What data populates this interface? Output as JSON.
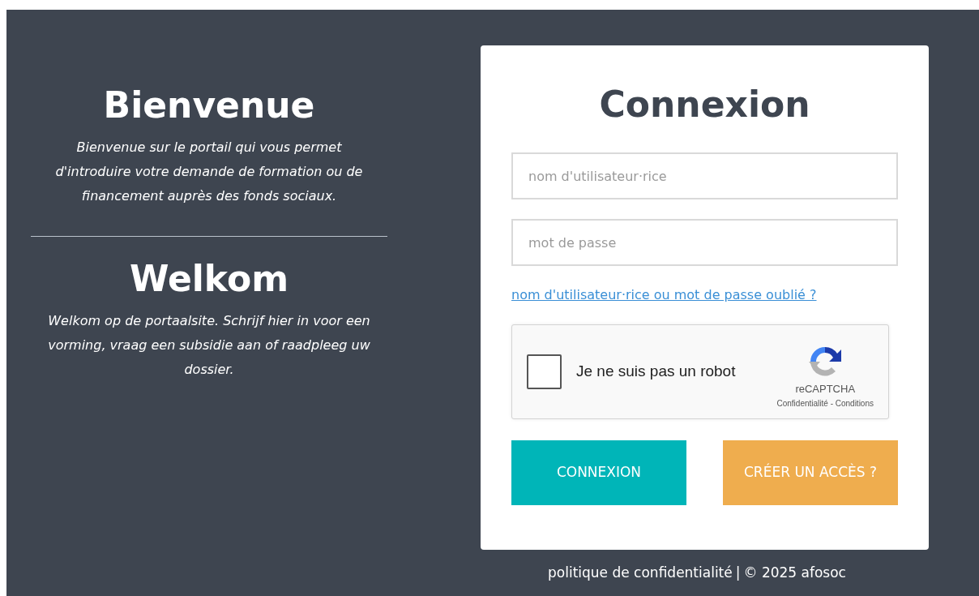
{
  "welcome_fr": {
    "title": "Bienvenue",
    "text": "Bienvenue sur le portail qui vous permet d'introduire votre demande de formation ou de financement auprès des fonds sociaux."
  },
  "welcome_nl": {
    "title": "Welkom",
    "text": "Welkom op de portaalsite. Schrijf hier in voor een vorming, vraag een subsidie aan of raadpleeg uw dossier."
  },
  "login": {
    "title": "Connexion",
    "fields": [
      {
        "placeholder": "nom d'utilisateur·rice"
      },
      {
        "placeholder": "mot de passe"
      }
    ],
    "forgot_link": "nom d'utilisateur·rice ou mot de passe oublié ?",
    "captcha": {
      "label": "Je ne suis pas un robot",
      "checked": false,
      "brand": "reCAPTCHA",
      "links": "Confidentialité - Conditions"
    },
    "buttons": [
      {
        "label": "CONNEXION",
        "kind": "primary"
      },
      {
        "label": "CRÉER UN ACCÈS ?",
        "kind": "secondary"
      }
    ]
  },
  "footer": {
    "link": "politique de confidentialité",
    "separator": "|",
    "copyright": "© 2025 afosoc"
  }
}
